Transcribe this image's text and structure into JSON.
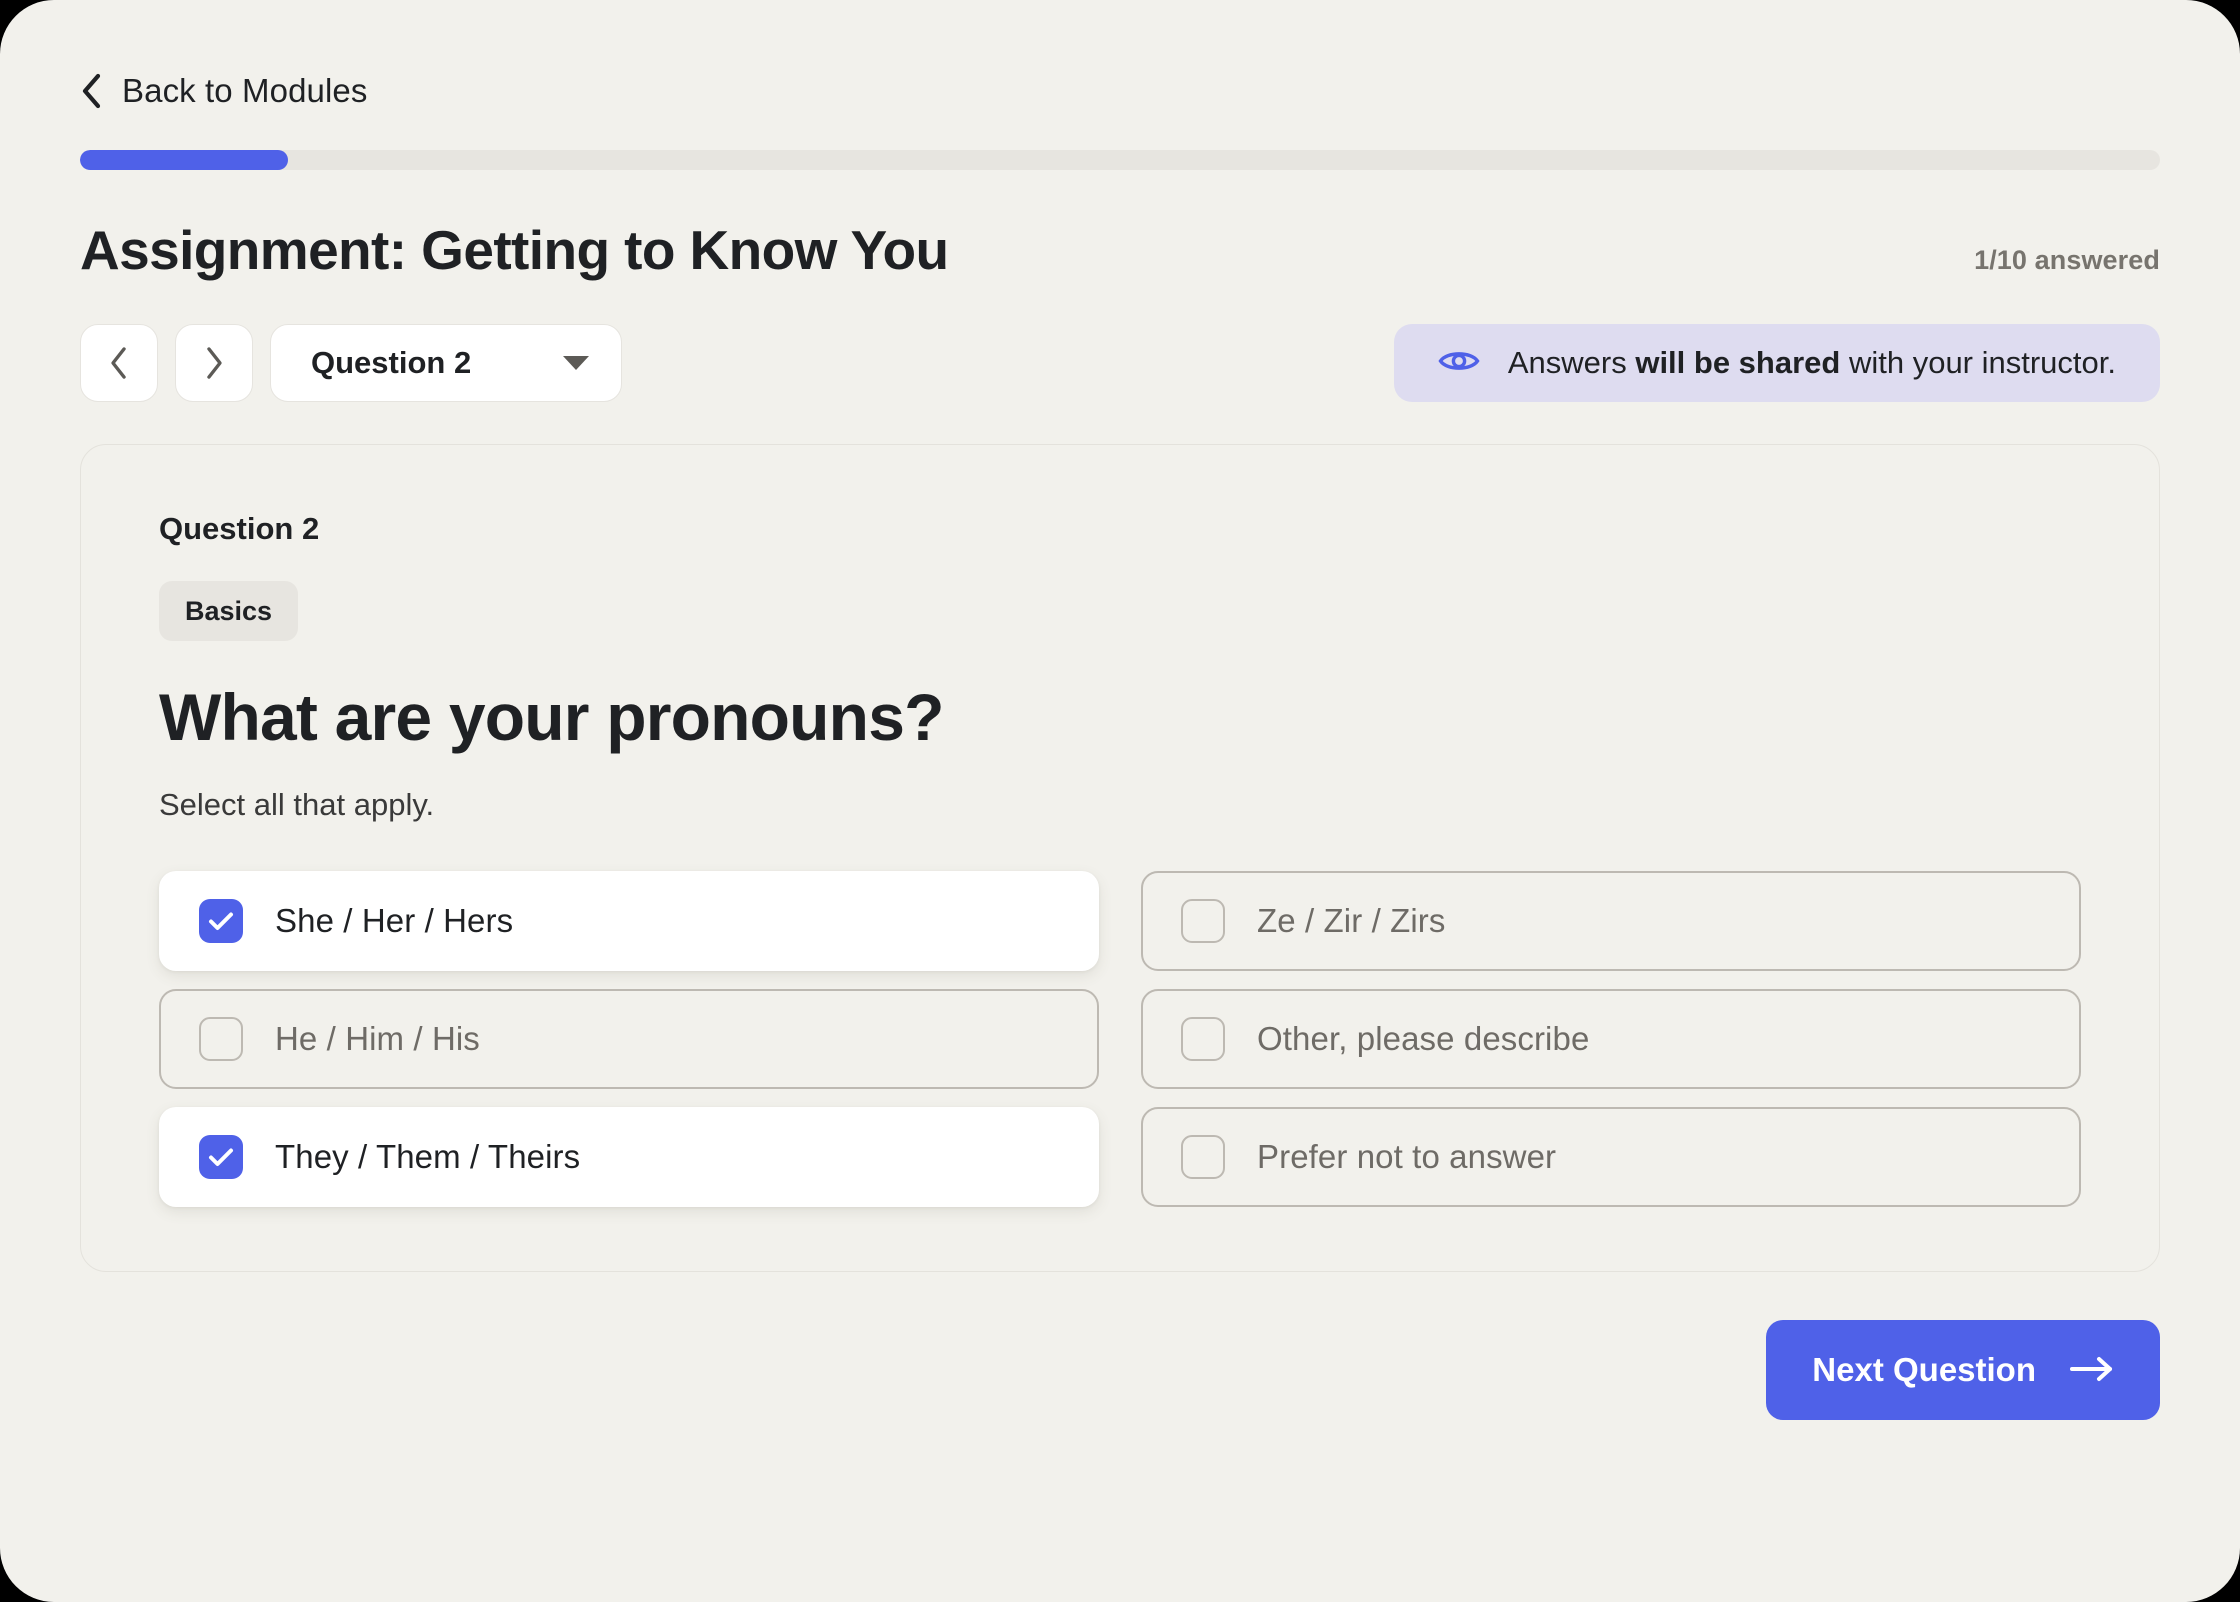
{
  "back_nav": {
    "label": "Back to Modules",
    "icon": "chevron-left-icon"
  },
  "progress": {
    "percent": 10
  },
  "header": {
    "title": "Assignment: Getting to Know You",
    "answered_status": "1/10 answered"
  },
  "nav": {
    "prev_icon": "chevron-left-icon",
    "next_icon": "chevron-right-icon",
    "question_selector": {
      "value": "Question 2",
      "caret_icon": "chevron-down-icon"
    }
  },
  "share_notice": {
    "icon": "eye-icon",
    "text_before": "Answers ",
    "text_emphasis": "will be shared",
    "text_after": " with your instructor.",
    "accent_color": "#4f61e8",
    "background_color": "#dedcf0"
  },
  "question": {
    "number_label": "Question 2",
    "tag": "Basics",
    "heading": "What are your pronouns?",
    "subtext": "Select all that apply.",
    "options": [
      {
        "label": "She / Her / Hers",
        "selected": true,
        "icon": "checkbox-checked-icon"
      },
      {
        "label": "Ze / Zir / Zirs",
        "selected": false,
        "icon": "checkbox-unchecked-icon"
      },
      {
        "label": "He / Him / His",
        "selected": false,
        "icon": "checkbox-unchecked-icon"
      },
      {
        "label": "Other, please describe",
        "selected": false,
        "icon": "checkbox-unchecked-icon"
      },
      {
        "label": "They / Them / Theirs",
        "selected": true,
        "icon": "checkbox-checked-icon"
      },
      {
        "label": "Prefer not to answer",
        "selected": false,
        "icon": "checkbox-unchecked-icon"
      }
    ]
  },
  "footer": {
    "next_button_label": "Next Question",
    "next_button_icon": "arrow-right-icon",
    "accent_color": "#4f61e8"
  }
}
